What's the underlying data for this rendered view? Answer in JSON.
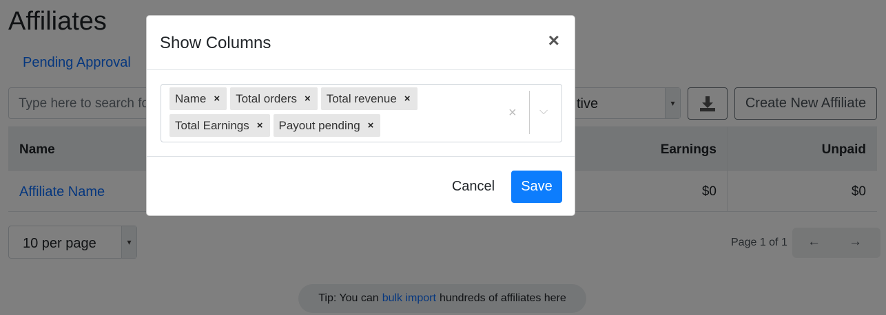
{
  "page": {
    "title": "Affiliates",
    "tab": "Pending Approval",
    "search_placeholder": "Type here to search fo",
    "status_value": "tive",
    "create_button": "Create New Affiliate",
    "table": {
      "headers": {
        "name": "Name",
        "earnings": "Earnings",
        "unpaid": "Unpaid"
      },
      "rows": [
        {
          "name": "Affiliate Name",
          "earnings": "$0",
          "unpaid": "$0"
        }
      ]
    },
    "per_page": "10 per page",
    "page_info": "Page 1 of 1",
    "prev_arrow": "←",
    "next_arrow": "→",
    "tip": {
      "prefix": "Tip: You can",
      "link": "bulk import",
      "suffix": "hundreds of affiliates here"
    }
  },
  "modal": {
    "title": "Show Columns",
    "close": "×",
    "chips": [
      "Name",
      "Total orders",
      "Total revenue",
      "Total Earnings",
      "Payout pending"
    ],
    "chip_remove": "×",
    "clear": "×",
    "chevron": "⌵",
    "cancel": "Cancel",
    "save": "Save"
  },
  "colors": {
    "primary": "#0d7dfd",
    "link": "#0d6efd",
    "backdrop": "rgba(0,0,0,0.5)"
  }
}
